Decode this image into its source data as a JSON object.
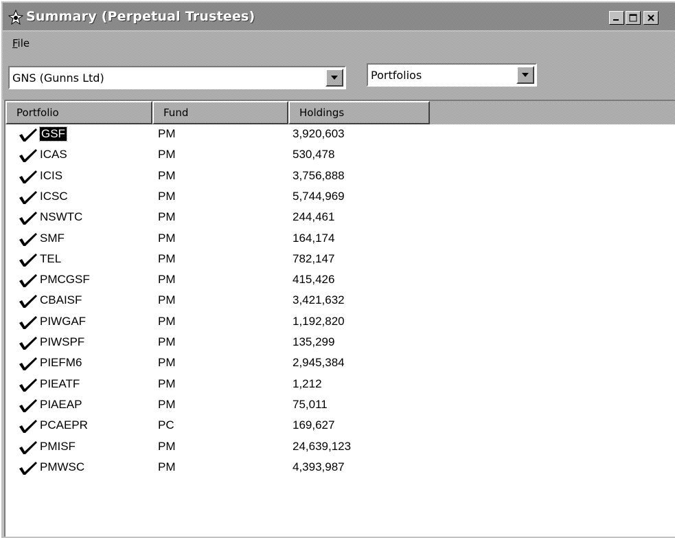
{
  "window": {
    "title": "Summary (Perpetual Trustees)",
    "controls": [
      "minimize-icon",
      "maximize-icon",
      "close-icon"
    ]
  },
  "menu": {
    "file_prefix": "F",
    "file_rest": "ile"
  },
  "security_combo": {
    "value": "GNS (Gunns Ltd)"
  },
  "view_combo": {
    "value": "Portfolios"
  },
  "list": {
    "columns": [
      "Portfolio",
      "Fund",
      "Holdings"
    ],
    "rows": [
      {
        "portfolio": "GSF",
        "fund": "PM",
        "holdings": "3,920,603",
        "selected": true
      },
      {
        "portfolio": "ICAS",
        "fund": "PM",
        "holdings": "530,478"
      },
      {
        "portfolio": "ICIS",
        "fund": "PM",
        "holdings": "3,756,888"
      },
      {
        "portfolio": "ICSC",
        "fund": "PM",
        "holdings": "5,744,969"
      },
      {
        "portfolio": "NSWTC",
        "fund": "PM",
        "holdings": "244,461"
      },
      {
        "portfolio": "SMF",
        "fund": "PM",
        "holdings": "164,174"
      },
      {
        "portfolio": "TEL",
        "fund": "PM",
        "holdings": "782,147"
      },
      {
        "portfolio": "PMCGSF",
        "fund": "PM",
        "holdings": "415,426"
      },
      {
        "portfolio": "CBAISF",
        "fund": "PM",
        "holdings": "3,421,632"
      },
      {
        "portfolio": "PIWGAF",
        "fund": "PM",
        "holdings": "1,192,820"
      },
      {
        "portfolio": "PIWSPF",
        "fund": "PM",
        "holdings": "135,299"
      },
      {
        "portfolio": "PIEFM6",
        "fund": "PM",
        "holdings": "2,945,384"
      },
      {
        "portfolio": "PIEATF",
        "fund": "PM",
        "holdings": "1,212"
      },
      {
        "portfolio": "PIAEAP",
        "fund": "PM",
        "holdings": "75,011"
      },
      {
        "portfolio": "PCAEPR",
        "fund": "PC",
        "holdings": "169,627"
      },
      {
        "portfolio": "PMISF",
        "fund": "PM",
        "holdings": "24,639,123"
      },
      {
        "portfolio": "PMWSC",
        "fund": "PM",
        "holdings": "4,393,987"
      }
    ]
  },
  "row_icon": "checkmark-icon"
}
